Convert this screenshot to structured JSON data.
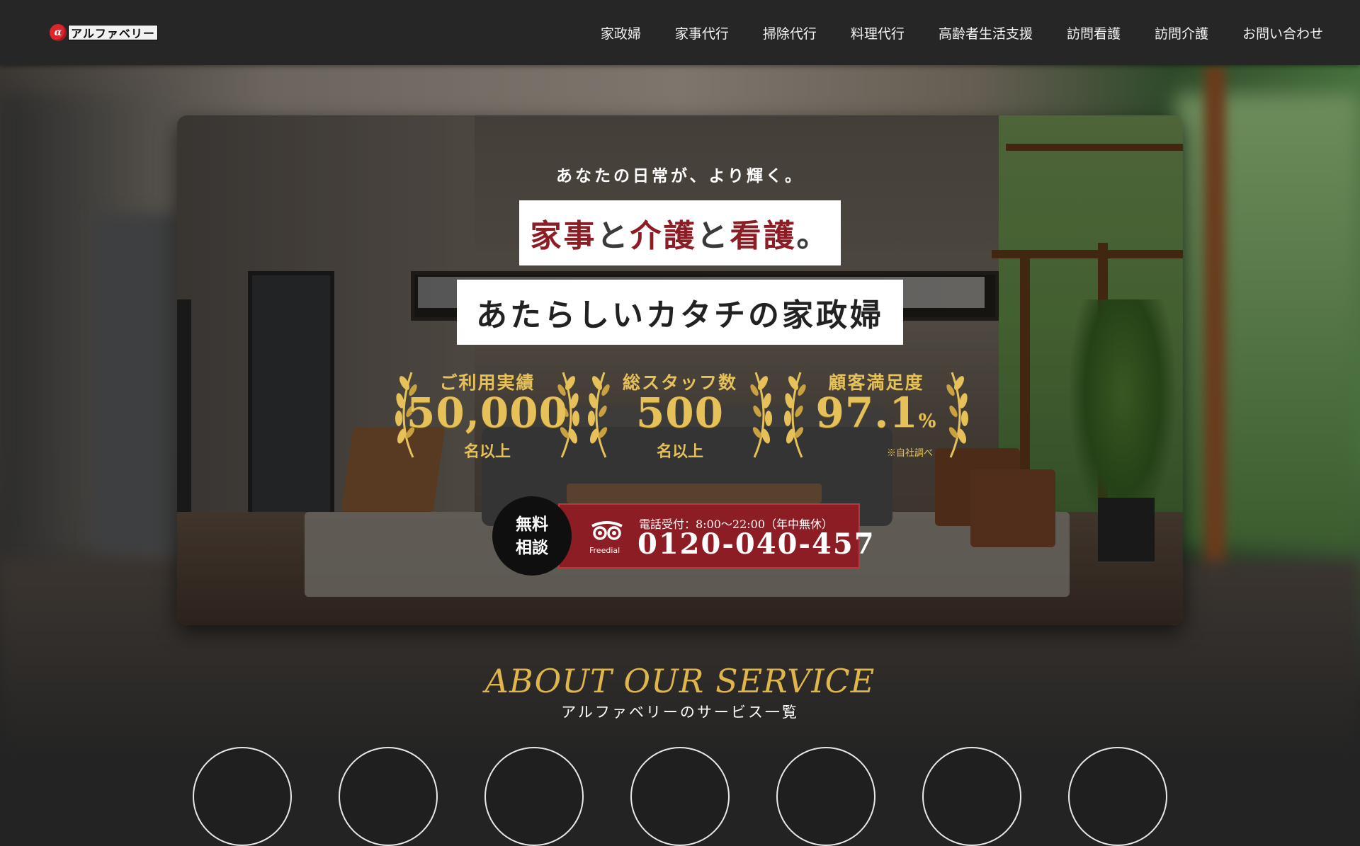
{
  "header": {
    "logo_mark": "α",
    "logo_text": "アルファベリー",
    "nav": [
      "家政婦",
      "家事代行",
      "掃除代行",
      "料理代行",
      "高齢者生活支援",
      "訪問看護",
      "訪問介護",
      "お問い合わせ"
    ]
  },
  "hero": {
    "tagline": "あなたの日常が、より輝く。",
    "headline1": {
      "part1": "家事",
      "part2": "と",
      "part3": "介護",
      "part4": "と",
      "part5": "看護",
      "part6": "。"
    },
    "headline2": "あたらしいカタチの家政婦",
    "stats": [
      {
        "label": "ご利用実績",
        "value": "50,000",
        "unit": "名以上",
        "note": ""
      },
      {
        "label": "総スタッフ数",
        "value": "500",
        "unit": "名以上",
        "note": ""
      },
      {
        "label": "顧客満足度",
        "value": "97.1",
        "unit": "%",
        "note": "※自社調べ"
      }
    ]
  },
  "cta": {
    "badge_line1": "無料",
    "badge_line2": "相談",
    "freedial_label": "Freedial",
    "hours": "電話受付：8:00〜22:00（年中無休）",
    "phone": "0120-040-457"
  },
  "about": {
    "title": "ABOUT OUR SERVICE",
    "subtitle": "アルファベリーのサービス一覧"
  },
  "colors": {
    "accent_gold": "#e6c15a",
    "accent_red": "#8c1d24",
    "header_bg": "#262626"
  },
  "icons": [
    "freedial-icon",
    "laurel-icon"
  ]
}
